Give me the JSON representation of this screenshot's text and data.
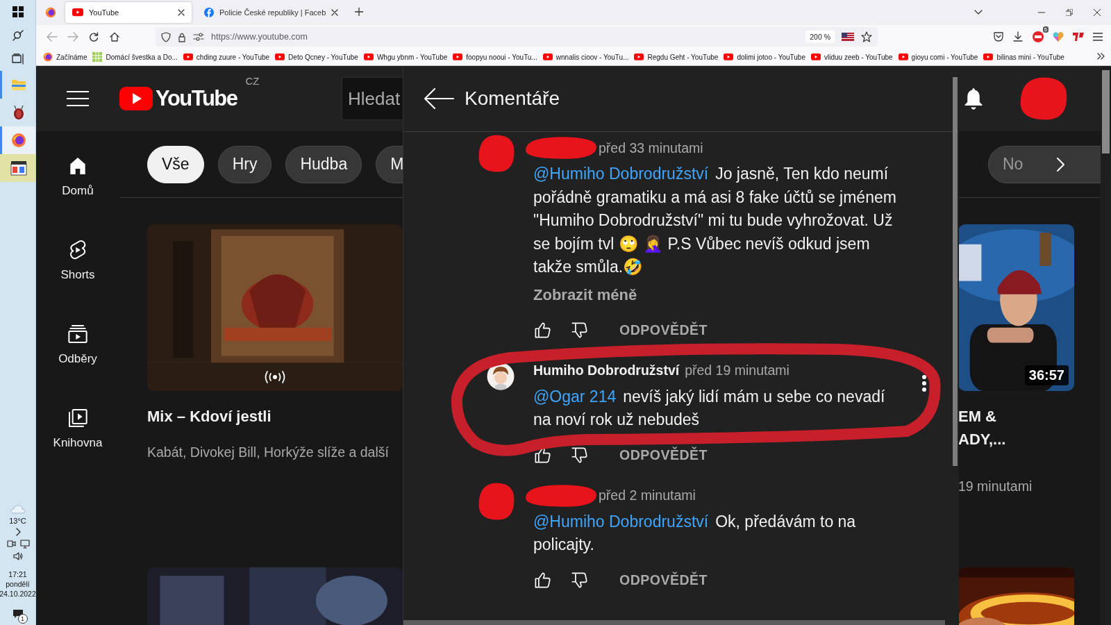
{
  "taskbar": {
    "apps": [
      {
        "kind": "folder",
        "running": true,
        "selected": false,
        "flashing": false
      },
      {
        "kind": "bug",
        "running": false,
        "selected": false,
        "flashing": false
      },
      {
        "kind": "browser",
        "running": true,
        "selected": true,
        "flashing": false
      },
      {
        "kind": "calendar",
        "running": false,
        "selected": false,
        "flashing": true
      }
    ],
    "temperature": "13°C",
    "time": "17:21",
    "day": "pondělí",
    "date": "24.10.2022",
    "notifications": "1"
  },
  "browser": {
    "tabs": [
      {
        "kind": "play",
        "title": "YouTube",
        "selected": true
      },
      {
        "kind": "facebook",
        "title": "Policie České republiky | Faceb",
        "selected": false
      }
    ],
    "address": "https://www.youtube.com",
    "zoom": "200 %",
    "extension_badge": "5",
    "bookmarks": [
      {
        "kind": "browser",
        "title": "Začínáme"
      },
      {
        "kind": "grid",
        "title": "Domácí švestka a Do..."
      },
      {
        "kind": "play",
        "title": "chding zuure - YouTube"
      },
      {
        "kind": "play",
        "title": "Deto Qcney - YouTube"
      },
      {
        "kind": "play",
        "title": "Whgu ybnm - YouTube"
      },
      {
        "kind": "play",
        "title": "foopyu nooui - YouTu..."
      },
      {
        "kind": "play",
        "title": "wnnalis cioov - YouTu..."
      },
      {
        "kind": "play",
        "title": "Regdu Geht - YouTube"
      },
      {
        "kind": "play",
        "title": "dolimi jotoo - YouTube"
      },
      {
        "kind": "play",
        "title": "vliduu zeeb - YouTube"
      },
      {
        "kind": "play",
        "title": "gioyu comi - YouTube"
      },
      {
        "kind": "play",
        "title": "bilinas mini - YouTube"
      }
    ]
  },
  "youtube": {
    "logo": "YouTube",
    "region": "CZ",
    "search_placeholder": "Hledat",
    "account_redacted": true,
    "guide": [
      {
        "kind": "home",
        "label": "Domů"
      },
      {
        "kind": "shorts",
        "label": "Shorts"
      },
      {
        "kind": "subscriptions",
        "label": "Odběry"
      },
      {
        "kind": "library",
        "label": "Knihovna"
      }
    ],
    "chips": [
      {
        "label": "Vše",
        "selected": true
      },
      {
        "label": "Hry",
        "selected": false
      },
      {
        "label": "Hudba",
        "selected": false
      },
      {
        "label": "M",
        "selected": false
      }
    ],
    "chip_right": {
      "label": "No",
      "selected": false
    },
    "columns": [
      [
        {
          "kind": "video",
          "title_lines": [
            "Mix – Kdoví jestli"
          ],
          "meta": "Kabát, Divokej Bill, Horkýže slíže a další",
          "live": true
        },
        {
          "kind": "picture"
        }
      ],
      [
        {
          "kind": "video",
          "title_lines": [
            "EM &",
            "ADY,..."
          ],
          "meta": "19 minutami",
          "live": false,
          "duration": "36:57"
        },
        {
          "kind": "picture"
        }
      ]
    ],
    "comments_panel": {
      "title": "Komentáře",
      "comments": [
        {
          "redacted": true,
          "time": "před 33 minutami",
          "mention": "@Humiho Dobrodružství",
          "text": "Jo jasně, Ten kdo neumí pořádně gramatiku a má asi 8 fake účtů se jménem \"Humiho Dobrodružství\" mi tu bude vyhrožovat. Už se bojím tvl 🙄 🤦‍♀️  P.S Vůbec nevíš odkud jsem takže smůla.🤣",
          "show_less": "Zobrazit méně",
          "reply": "ODPOVĚDĚT",
          "menu": false,
          "circled": false
        },
        {
          "redacted": false,
          "author": "Humiho Dobrodružství",
          "time": "před 19 minutami",
          "mention": "@Ogar 214",
          "text": "nevíš jaký lidí mám u sebe co nevadí na noví rok už nebudeš",
          "reply": "ODPOVĚDĚT",
          "menu": true,
          "circled": true
        },
        {
          "redacted": true,
          "time": "před 2 minutami",
          "mention": "@Humiho Dobrodružství",
          "text": "Ok, předávám to na policajty.",
          "reply": "ODPOVĚDĚT",
          "menu": false,
          "circled": false
        }
      ]
    }
  }
}
